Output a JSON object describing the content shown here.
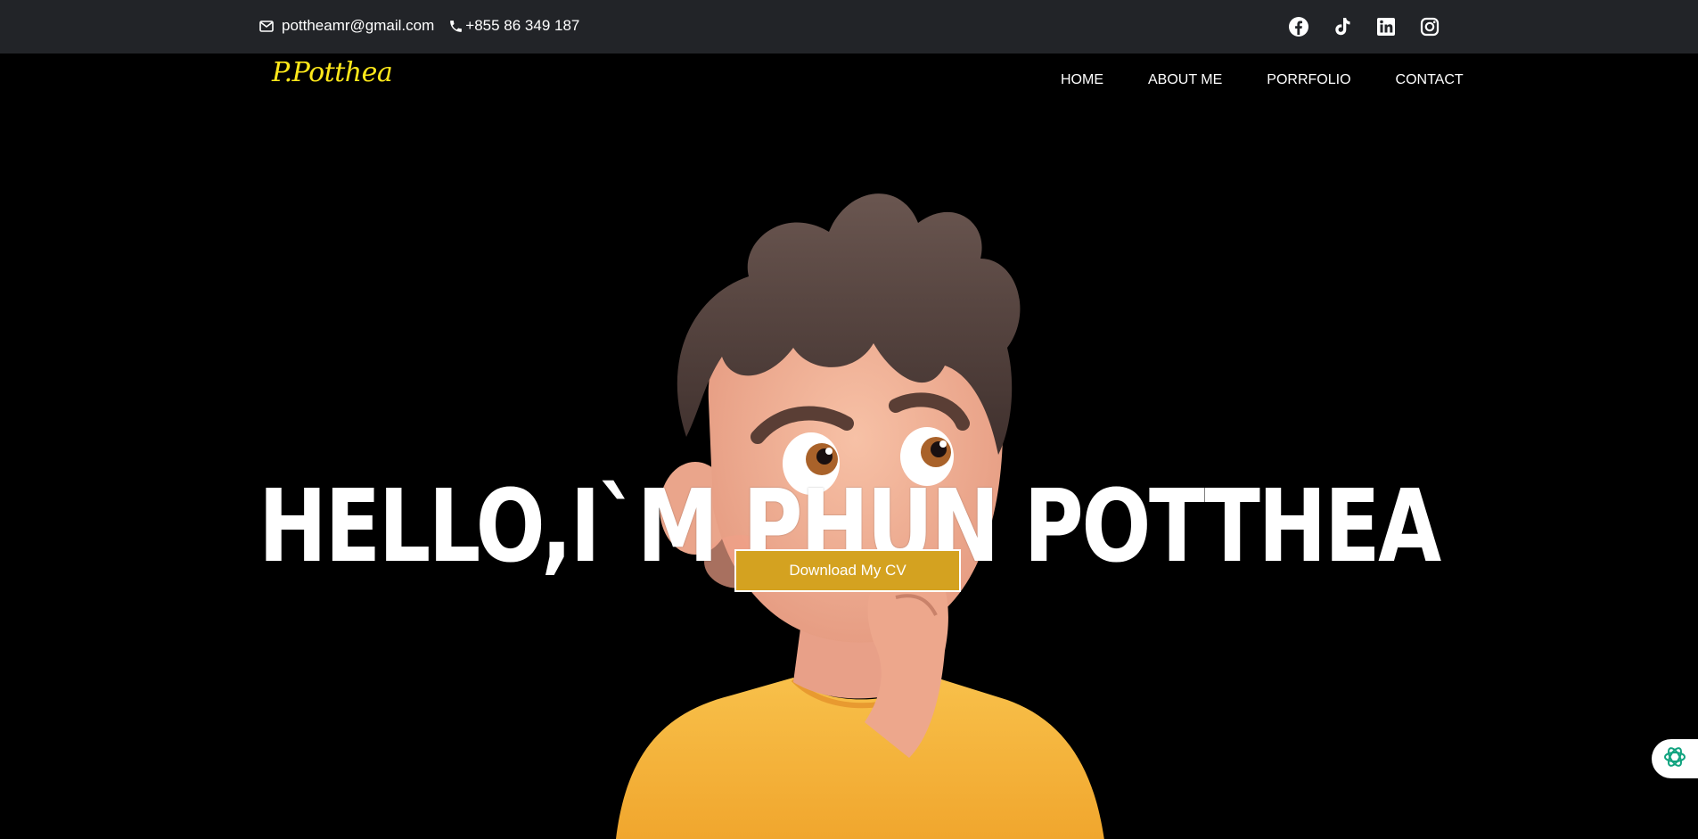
{
  "topbar": {
    "email": "pottheamr@gmail.com",
    "phone": "+855 86 349 187",
    "social": [
      "facebook-icon",
      "tiktok-icon",
      "linkedin-icon",
      "instagram-icon"
    ]
  },
  "nav": {
    "logo": "P.Potthea",
    "items": [
      "HOME",
      "ABOUT ME",
      "PORRFOLIO",
      "CONTACT"
    ]
  },
  "hero": {
    "headline": "HELLO,I`M PHUN POTTHEA",
    "cv_button": "Download My CV"
  },
  "colors": {
    "topbar_bg": "#222428",
    "page_bg": "#000000",
    "logo": "#ffe81a",
    "button": "#d4a220",
    "shirt": "#f5b73a",
    "assist_icon": "#10a37f"
  }
}
